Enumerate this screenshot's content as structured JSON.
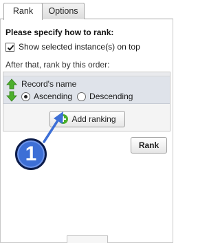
{
  "tabs": [
    {
      "label": "Rank",
      "active": true
    },
    {
      "label": "Options",
      "active": false
    }
  ],
  "heading": "Please specify how to rank:",
  "show_selected": {
    "label": "Show selected instance(s) on top",
    "checked": true
  },
  "order_label": "After that, rank by this order:",
  "ranking": {
    "field": "Record's name",
    "options": [
      {
        "label": "Ascending",
        "selected": true
      },
      {
        "label": "Descending",
        "selected": false
      }
    ]
  },
  "add_ranking_label": "Add ranking",
  "rank_button_label": "Rank",
  "callout_number": "1",
  "colors": {
    "arrow_green": "#4caf2c",
    "callout_blue": "#3d6fd6",
    "selected_row": "#dfe3ea"
  }
}
